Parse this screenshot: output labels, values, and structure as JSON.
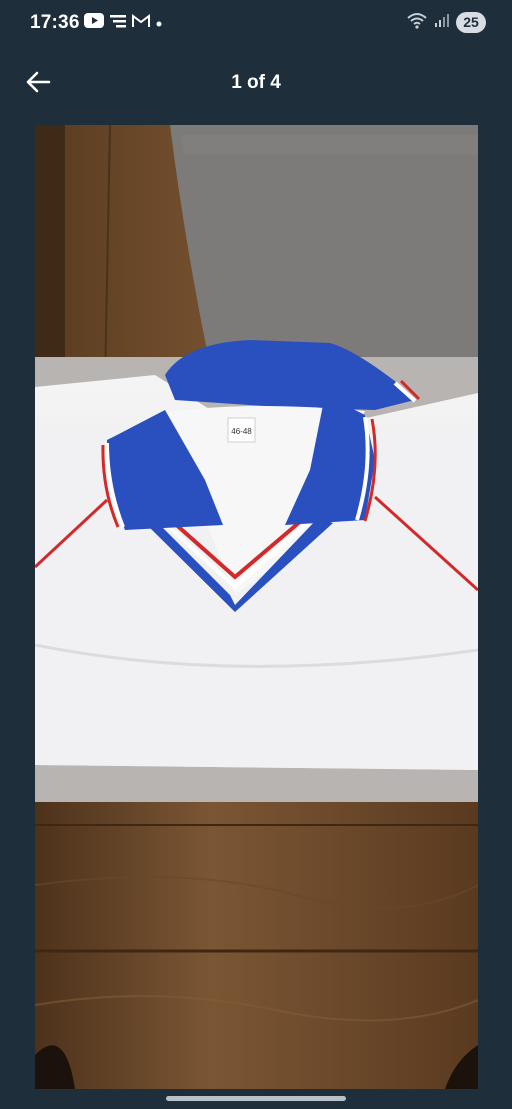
{
  "status_bar": {
    "time": "17:36",
    "battery": "25",
    "left_icons": [
      "youtube-icon",
      "notes-icon",
      "gmail-icon",
      "dot-icon"
    ],
    "right_icons": [
      "wifi-icon",
      "signal-icon",
      "battery-icon"
    ]
  },
  "header": {
    "back_icon": "arrow-left-icon",
    "counter": "1 of 4"
  },
  "photo": {
    "tag_text": "46-48"
  },
  "colors": {
    "background": "#1f2e3b",
    "collar_blue": "#2a4fbe",
    "trim_red": "#d22a2a"
  }
}
